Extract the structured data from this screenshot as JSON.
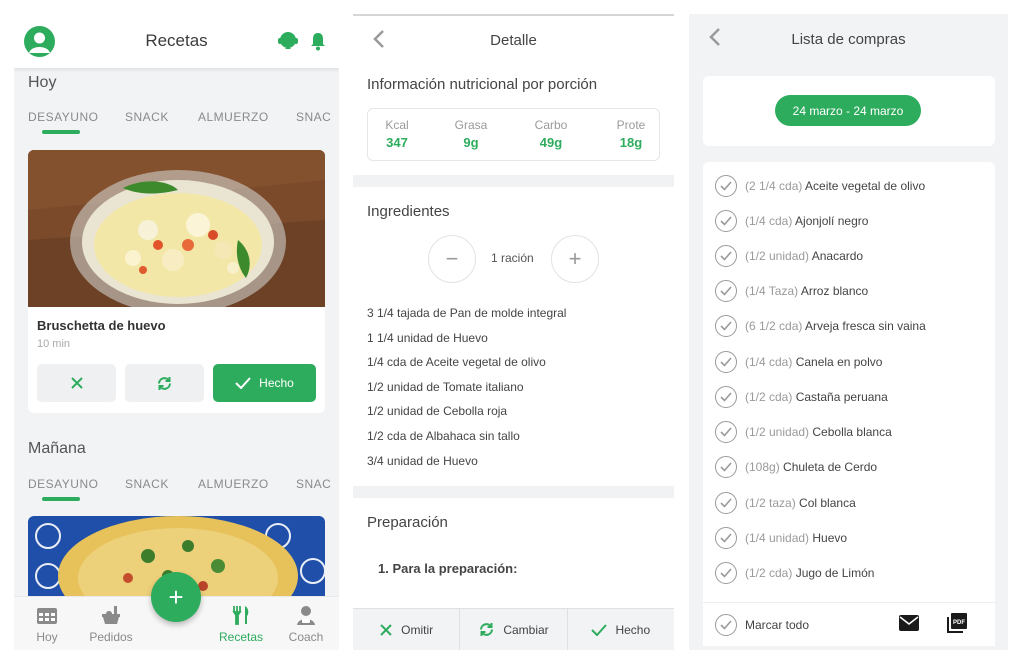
{
  "colors": {
    "accent": "#2eac5d",
    "background": "#f2f3f5",
    "text": "#3a3a3a",
    "muted": "#9a9a9a"
  },
  "screen1": {
    "title": "Recetas",
    "days": [
      {
        "label": "Hoy",
        "tabs": [
          "DESAYUNO",
          "SNACK",
          "ALMUERZO",
          "SNAC"
        ],
        "active_tab": 0,
        "card": {
          "name": "Bruschetta de huevo",
          "time": "10 min",
          "actions": {
            "skip_icon": "x-icon",
            "swap_icon": "refresh-icon",
            "done": "Hecho"
          }
        }
      },
      {
        "label": "Mañana",
        "tabs": [
          "DESAYUNO",
          "SNACK",
          "ALMUERZO",
          "SNAC"
        ],
        "active_tab": 0
      }
    ],
    "tabbar": [
      "Hoy",
      "Pedidos",
      "Recetas",
      "Coach"
    ],
    "active_tabbar": 2,
    "fab": "+"
  },
  "screen2": {
    "title": "Detalle",
    "nutrition": {
      "title": "Información nutricional por porción",
      "items": [
        {
          "k": "Kcal",
          "v": "347"
        },
        {
          "k": "Grasa",
          "v": "9g"
        },
        {
          "k": "Carbo",
          "v": "49g"
        },
        {
          "k": "Prote",
          "v": "18g"
        }
      ]
    },
    "ingredients": {
      "title": "Ingredientes",
      "servings": "1 ración",
      "minus": "−",
      "plus": "+",
      "list": [
        "3 1/4 tajada de Pan de molde integral",
        "1 1/4 unidad de Huevo",
        "1/4 cda de Aceite vegetal de olivo",
        "1/2 unidad de Tomate italiano",
        "1/2 unidad de Cebolla roja",
        "1/2 cda de Albahaca sin tallo",
        "3/4 unidad de Huevo"
      ]
    },
    "preparation": {
      "title": "Preparación",
      "step1": "1. Para la preparación:"
    },
    "bottom": [
      "Omitir",
      "Cambiar",
      "Hecho"
    ]
  },
  "screen3": {
    "title": "Lista de compras",
    "date_range": "24 marzo - 24 marzo",
    "items": [
      {
        "qty": "(2 1/4 cda)",
        "name": "Aceite vegetal de olivo"
      },
      {
        "qty": "(1/4 cda)",
        "name": "Ajonjolí negro"
      },
      {
        "qty": "(1/2 unidad)",
        "name": "Anacardo"
      },
      {
        "qty": "(1/4 Taza)",
        "name": "Arroz blanco"
      },
      {
        "qty": "(6 1/2 cda)",
        "name": "Arveja fresca sin vaina"
      },
      {
        "qty": "(1/4 cda)",
        "name": "Canela en polvo"
      },
      {
        "qty": "(1/2 cda)",
        "name": "Castaña peruana"
      },
      {
        "qty": "(1/2 unidad)",
        "name": "Cebolla blanca"
      },
      {
        "qty": "(108g)",
        "name": "Chuleta de Cerdo"
      },
      {
        "qty": "(1/2 taza)",
        "name": "Col blanca"
      },
      {
        "qty": "(1/4 unidad)",
        "name": "Huevo"
      },
      {
        "qty": "(1/2 cda)",
        "name": "Jugo de Limón"
      }
    ],
    "mark_all": "Marcar todo",
    "footer_icons": [
      "mail-icon",
      "pdf-icon"
    ]
  }
}
